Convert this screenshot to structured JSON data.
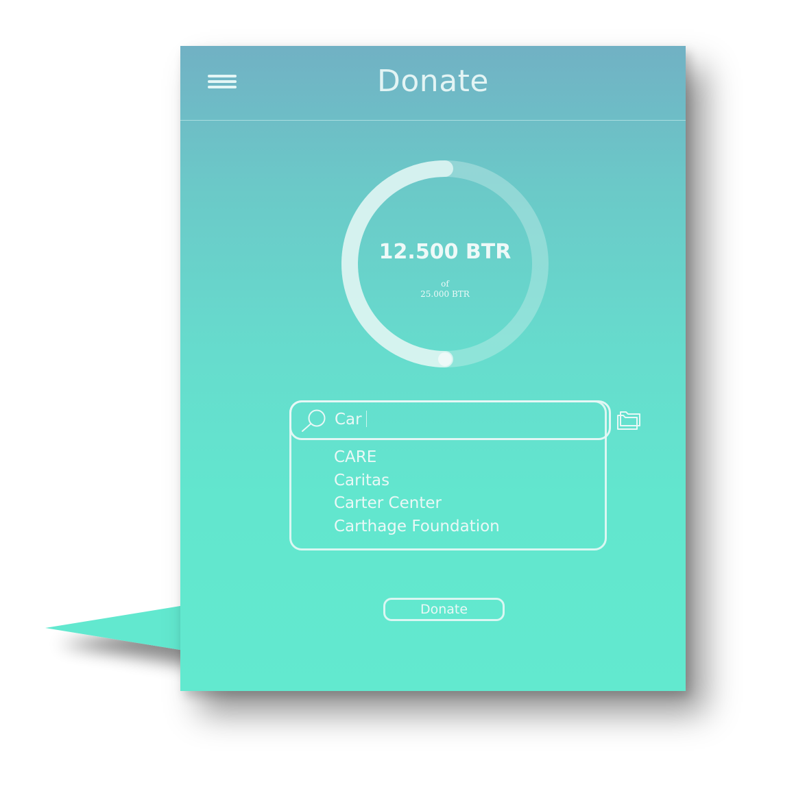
{
  "header": {
    "title": "Donate",
    "menu_icon": "hamburger-menu-icon"
  },
  "progress": {
    "amount_label": "12.500 BTR",
    "of_label": "of",
    "goal_label": "25.000 BTR",
    "fraction": 0.5
  },
  "search": {
    "value": "Car",
    "icon": "search-icon",
    "suggestions": [
      "CARE",
      "Caritas",
      "Carter Center",
      "Carthage Foundation"
    ]
  },
  "folder_icon": "folder-icon",
  "donate_button": {
    "label": "Donate"
  },
  "colors": {
    "gradient_top": "#71b1c4",
    "gradient_bottom": "#62e9cf",
    "foreground": "#e3f4f4"
  }
}
